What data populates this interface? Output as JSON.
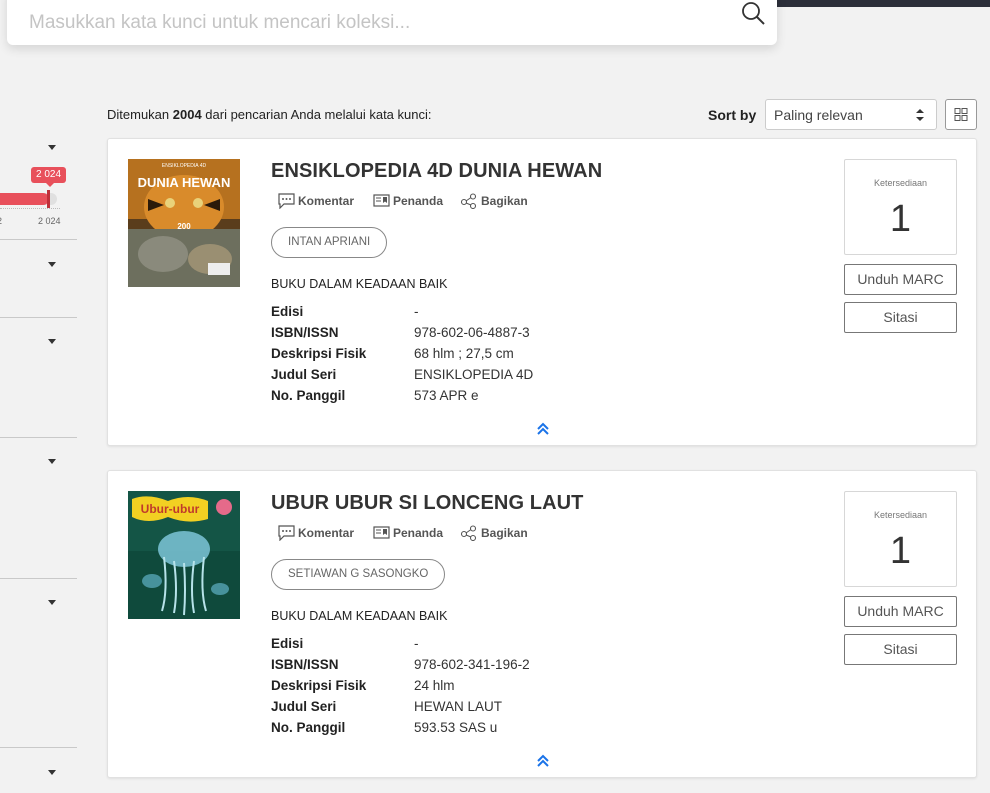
{
  "search": {
    "placeholder": "Masukkan kata kunci untuk mencari koleksi..."
  },
  "filters": {
    "year_badge": "2 024",
    "range_min_label": "2",
    "range_max_label": "2 024"
  },
  "results": {
    "prefix": "Ditemukan ",
    "count": "2004",
    "suffix": " dari pencarian Anda melalui kata kunci:"
  },
  "sort": {
    "label": "Sort by",
    "selected": "Paling relevan"
  },
  "labels": {
    "comment": "Komentar",
    "bookmark": "Penanda",
    "share": "Bagikan",
    "availability": "Ketersediaan",
    "download_marc": "Unduh MARC",
    "cite": "Sitasi",
    "edition": "Edisi",
    "isbn": "ISBN/ISSN",
    "physical": "Deskripsi Fisik",
    "series": "Judul Seri",
    "call_number": "No. Panggil"
  },
  "items": [
    {
      "title": "ENSIKLOPEDIA 4D DUNIA HEWAN",
      "cover_text": "DUNIA HEWAN",
      "cover_top_text": "ENSIKLOPEDIA 4D",
      "author": "INTAN APRIANI",
      "condition": "BUKU DALAM KEADAAN BAIK",
      "edition": "-",
      "isbn": "978-602-06-4887-3",
      "physical": "68 hlm ; 27,5 cm",
      "series": "ENSIKLOPEDIA 4D",
      "call_number": "573 APR e",
      "availability": "1",
      "colors": {
        "cover_bg": "#6b4a22",
        "cover_accent": "#d98b2b"
      }
    },
    {
      "title": "UBUR UBUR SI LONCENG LAUT",
      "cover_text": "Ubur-ubur",
      "cover_top_text": "",
      "author": "SETIAWAN G SASONGKO",
      "condition": "BUKU DALAM KEADAAN BAIK",
      "edition": "-",
      "isbn": "978-602-341-196-2",
      "physical": "24 hlm",
      "series": "HEWAN LAUT",
      "call_number": "593.53 SAS u",
      "availability": "1",
      "colors": {
        "cover_bg": "#1d6a5a",
        "cover_accent": "#f2d022"
      }
    }
  ],
  "colors": {
    "accent": "#e8505b",
    "link_blue": "#1a73e8"
  }
}
